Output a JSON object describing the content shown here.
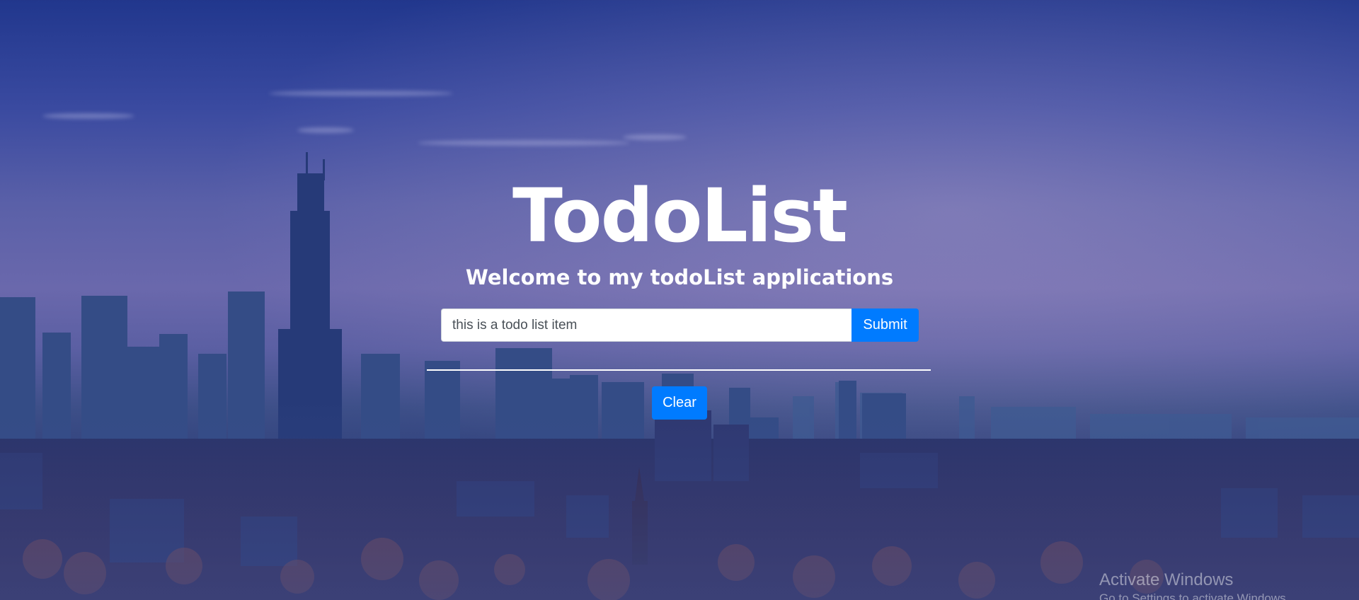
{
  "app": {
    "title": "TodoList",
    "subtitle": "Welcome to my todoList applications"
  },
  "form": {
    "input_value": "this is a todo list item",
    "submit_label": "Submit"
  },
  "actions": {
    "clear_label": "Clear"
  },
  "os_watermark": {
    "title": "Activate Windows",
    "subtitle": "Go to Settings to activate Windows."
  },
  "colors": {
    "primary_button": "#007bff",
    "text_on_background": "#ffffff"
  }
}
